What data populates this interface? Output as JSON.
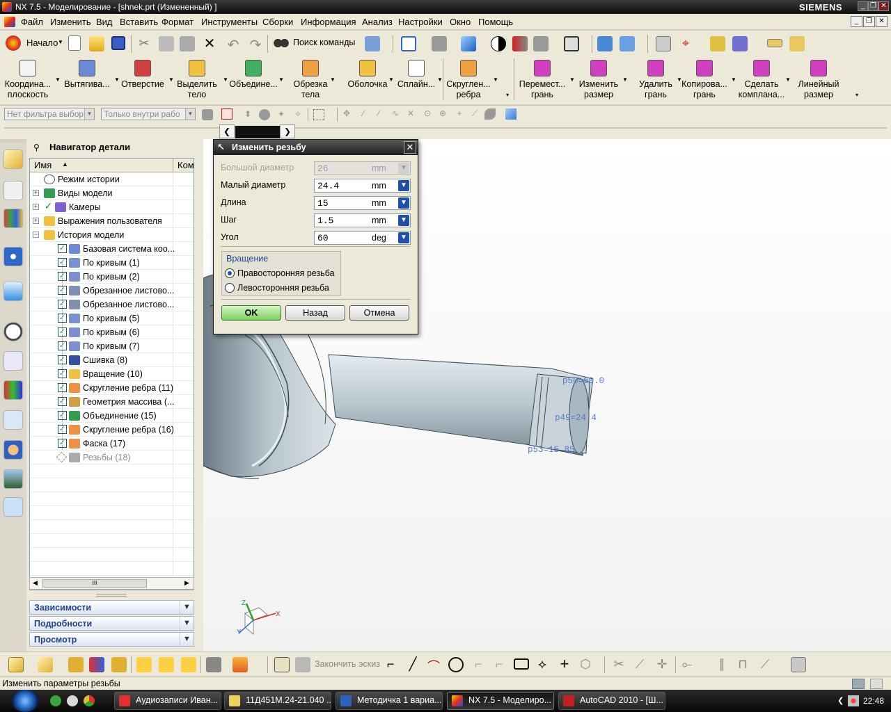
{
  "window": {
    "title": "NX 7.5 - Моделирование - [shnek.prt (Измененный) ]",
    "brand": "SIEMENS"
  },
  "menu": [
    "Файл",
    "Изменить",
    "Вид",
    "Вставить",
    "Формат",
    "Инструменты",
    "Сборки",
    "Информация",
    "Анализ",
    "Настройки",
    "Окно",
    "Помощь"
  ],
  "toolbar1": {
    "start_label": "Начало",
    "search_label": "Поиск команды"
  },
  "toolbar2": [
    {
      "l1": "Координа...",
      "l2": "плоскость"
    },
    {
      "l1": "Вытягива...",
      "l2": ""
    },
    {
      "l1": "Отверстие",
      "l2": ""
    },
    {
      "l1": "Выделить",
      "l2": "тело"
    },
    {
      "l1": "Объедине...",
      "l2": ""
    },
    {
      "l1": "Обрезка",
      "l2": "тела"
    },
    {
      "l1": "Оболочка",
      "l2": ""
    },
    {
      "l1": "Сплайн...",
      "l2": ""
    },
    {
      "l1": "Скруглен...",
      "l2": "ребра"
    },
    {
      "l1": "Перемест...",
      "l2": "грань"
    },
    {
      "l1": "Изменить",
      "l2": "размер"
    },
    {
      "l1": "Удалить",
      "l2": "грань"
    },
    {
      "l1": "Копирова...",
      "l2": "грань"
    },
    {
      "l1": "Сделать",
      "l2": "комплана..."
    },
    {
      "l1": "Линейный",
      "l2": "размер"
    }
  ],
  "filters": {
    "type_filter": "Нет фильтра выбор",
    "scope_filter": "Только внутри рабо"
  },
  "navigator": {
    "title": "Навигатор детали",
    "col_name": "Имя",
    "col_comment": "Ком",
    "items": [
      {
        "label": "Режим истории",
        "indent": 1,
        "check": false,
        "expand": false
      },
      {
        "label": "Виды модели",
        "indent": 0,
        "check": false,
        "expand": true
      },
      {
        "label": "Камеры",
        "indent": 0,
        "check": true,
        "expand": true
      },
      {
        "label": "Выражения пользователя",
        "indent": 0,
        "check": false,
        "expand": true
      },
      {
        "label": "История модели",
        "indent": 0,
        "check": false,
        "expand": true
      },
      {
        "label": "Базовая система коо...",
        "indent": 2,
        "check": true,
        "expand": false
      },
      {
        "label": "По кривым (1)",
        "indent": 2,
        "check": true,
        "expand": false
      },
      {
        "label": "По кривым (2)",
        "indent": 2,
        "check": true,
        "expand": false
      },
      {
        "label": "Обрезанное листово...",
        "indent": 2,
        "check": true,
        "expand": false
      },
      {
        "label": "Обрезанное листово...",
        "indent": 2,
        "check": true,
        "expand": false
      },
      {
        "label": "По кривым (5)",
        "indent": 2,
        "check": true,
        "expand": false
      },
      {
        "label": "По кривым (6)",
        "indent": 2,
        "check": true,
        "expand": false
      },
      {
        "label": "По кривым (7)",
        "indent": 2,
        "check": true,
        "expand": false
      },
      {
        "label": "Сшивка (8)",
        "indent": 2,
        "check": true,
        "expand": false
      },
      {
        "label": "Вращение (10)",
        "indent": 2,
        "check": true,
        "expand": false
      },
      {
        "label": "Скругление ребра (11)",
        "indent": 2,
        "check": true,
        "expand": false
      },
      {
        "label": "Геометрия массива (...",
        "indent": 2,
        "check": true,
        "expand": false
      },
      {
        "label": "Объединение (15)",
        "indent": 2,
        "check": true,
        "expand": false
      },
      {
        "label": "Скругление ребра (16)",
        "indent": 2,
        "check": true,
        "expand": false
      },
      {
        "label": "Фаска (17)",
        "indent": 2,
        "check": true,
        "expand": false
      },
      {
        "label": "Резьбы (18)",
        "indent": 2,
        "check": false,
        "expand": false,
        "grey": true
      }
    ],
    "panels": [
      "Зависимости",
      "Подробности",
      "Просмотр"
    ]
  },
  "dialog": {
    "title": "Изменить резьбу",
    "fields": [
      {
        "label": "Большой диаметр",
        "value": "26",
        "unit": "mm",
        "disabled": true
      },
      {
        "label": "Малый диаметр",
        "value": "24.4",
        "unit": "mm",
        "disabled": false
      },
      {
        "label": "Длина",
        "value": "15",
        "unit": "mm",
        "disabled": false
      },
      {
        "label": "Шаг",
        "value": "1.5",
        "unit": "mm",
        "disabled": false
      },
      {
        "label": "Угол",
        "value": "60",
        "unit": "deg",
        "disabled": false
      }
    ],
    "rotation_group": "Вращение",
    "right_hand": "Правосторонняя резьба",
    "left_hand": "Левосторонняя резьба",
    "selected": "right",
    "ok": "OK",
    "back": "Назад",
    "cancel": "Отмена"
  },
  "viewport": {
    "dim1": "p50=60.0",
    "dim2": "p49=24.4",
    "dim3": "p53=15.85",
    "triad_x": "X",
    "triad_y": "Y",
    "triad_z": "Z",
    "part_color": "#b8c4cc"
  },
  "bottom_toolbar": {
    "finish_sketch": "Закончить эскиз"
  },
  "status": "Изменить параметры резьбы",
  "taskbar": {
    "tasks": [
      "Аудиозаписи Иван...",
      "11Д451М.24-21.040 ...",
      "Методичка 1 вариа...",
      "NX 7.5 - Моделиро...",
      "AutoCAD 2010 - [Ш..."
    ],
    "active_index": 3,
    "time": "22:48"
  }
}
